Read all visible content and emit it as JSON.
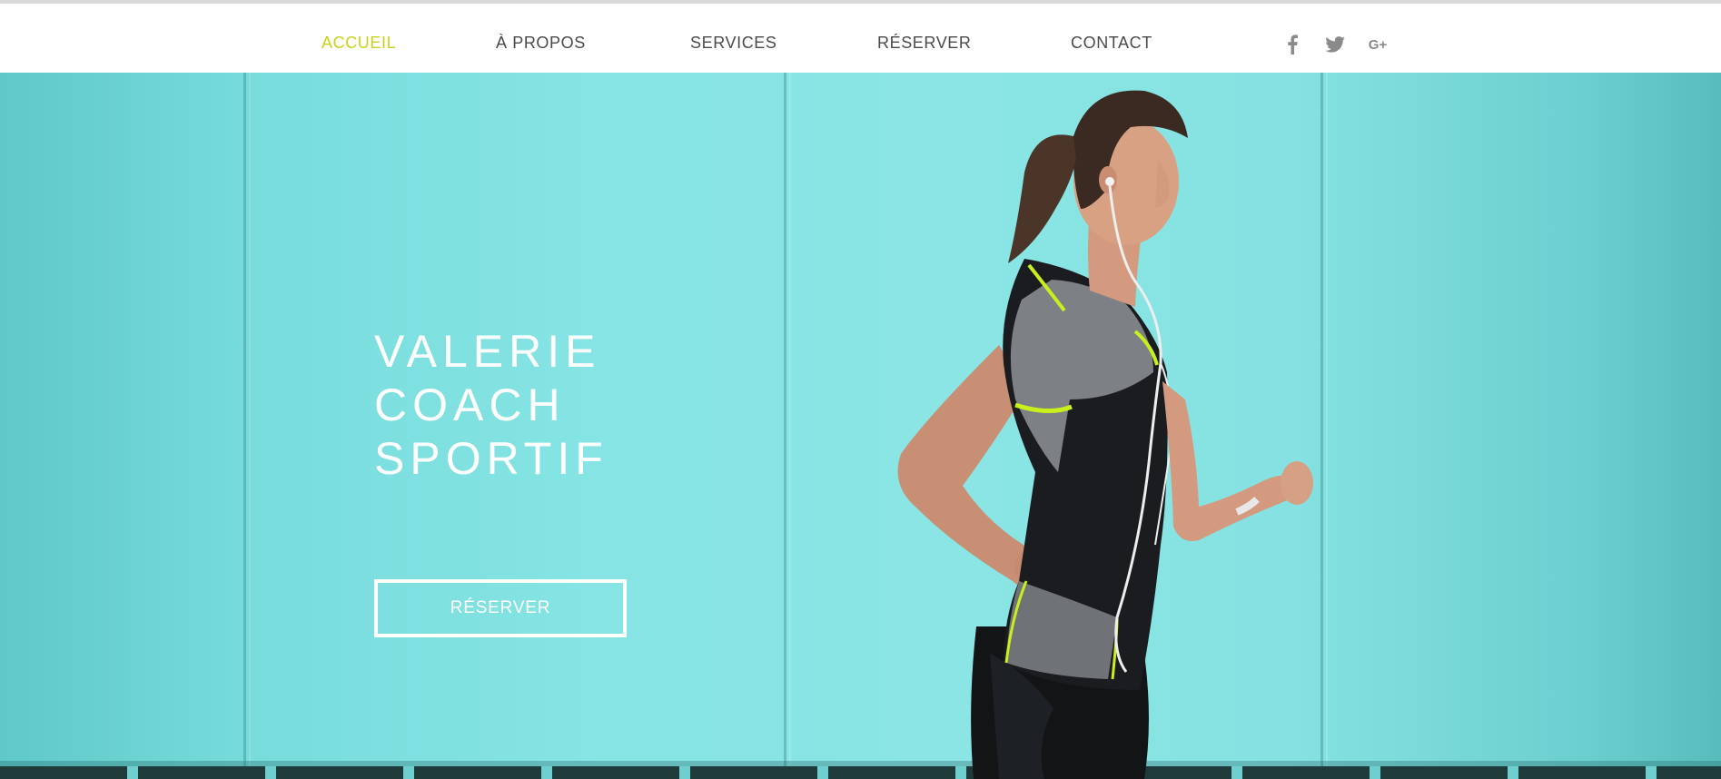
{
  "nav": {
    "items": [
      {
        "label": "ACCUEIL",
        "active": true
      },
      {
        "label": "À PROPOS",
        "active": false
      },
      {
        "label": "SERVICES",
        "active": false
      },
      {
        "label": "RÉSERVER",
        "active": false
      },
      {
        "label": "CONTACT",
        "active": false
      }
    ],
    "social": [
      "facebook-icon",
      "twitter-icon",
      "google-plus-icon"
    ],
    "google_plus_glyph": "G+"
  },
  "hero": {
    "title_lines": [
      "VALERIE",
      "COACH",
      "SPORTIF"
    ],
    "cta_label": "RÉSERVER",
    "image": "woman-running-photo"
  },
  "colors": {
    "accent": "#c8d21a",
    "nav_text": "#4a4a4a",
    "hero_background": "#86e4e4",
    "hero_text": "#ffffff"
  }
}
